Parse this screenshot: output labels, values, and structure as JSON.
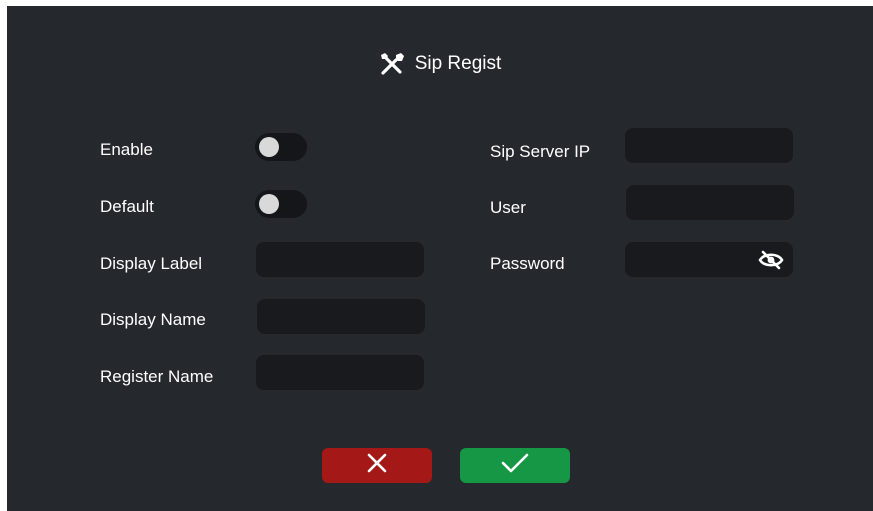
{
  "dialog": {
    "title": "Sip Regist",
    "title_icon": "tools-icon"
  },
  "left": {
    "enable": {
      "label": "Enable",
      "on": false
    },
    "default": {
      "label": "Default",
      "on": false
    },
    "display_label": {
      "label": "Display Label",
      "value": ""
    },
    "display_name": {
      "label": "Display Name",
      "value": ""
    },
    "register_name": {
      "label": "Register Name",
      "value": ""
    }
  },
  "right": {
    "sip_server_ip": {
      "label": "Sip Server IP",
      "value": ""
    },
    "user": {
      "label": "User",
      "value": ""
    },
    "password": {
      "label": "Password",
      "value": "",
      "visibility_icon": "eye-off-icon"
    }
  },
  "actions": {
    "cancel_icon": "close-icon",
    "confirm_icon": "check-icon"
  },
  "colors": {
    "background": "#25282d",
    "field": "#181a1e",
    "cancel": "#a51818",
    "confirm": "#159745",
    "toggle_knob": "#d9d9d9"
  }
}
